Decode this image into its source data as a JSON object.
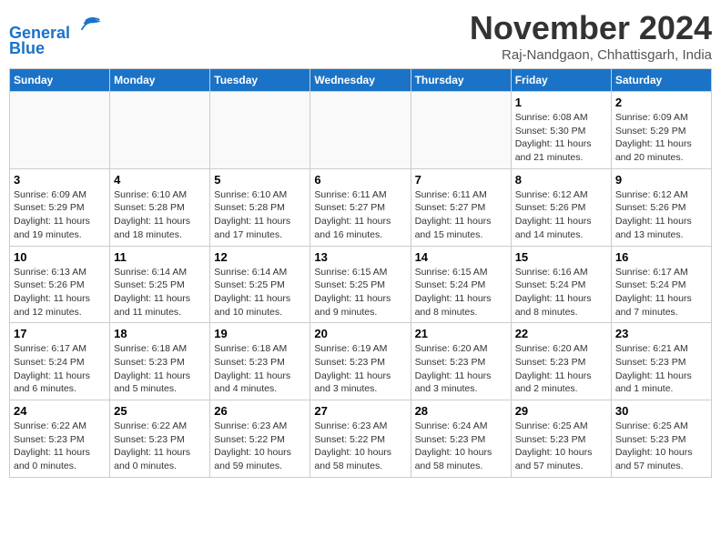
{
  "header": {
    "logo_line1": "General",
    "logo_line2": "Blue",
    "month_title": "November 2024",
    "location": "Raj-Nandgaon, Chhattisgarh, India"
  },
  "weekdays": [
    "Sunday",
    "Monday",
    "Tuesday",
    "Wednesday",
    "Thursday",
    "Friday",
    "Saturday"
  ],
  "weeks": [
    [
      {
        "day": "",
        "info": ""
      },
      {
        "day": "",
        "info": ""
      },
      {
        "day": "",
        "info": ""
      },
      {
        "day": "",
        "info": ""
      },
      {
        "day": "",
        "info": ""
      },
      {
        "day": "1",
        "info": "Sunrise: 6:08 AM\nSunset: 5:30 PM\nDaylight: 11 hours and 21 minutes."
      },
      {
        "day": "2",
        "info": "Sunrise: 6:09 AM\nSunset: 5:29 PM\nDaylight: 11 hours and 20 minutes."
      }
    ],
    [
      {
        "day": "3",
        "info": "Sunrise: 6:09 AM\nSunset: 5:29 PM\nDaylight: 11 hours and 19 minutes."
      },
      {
        "day": "4",
        "info": "Sunrise: 6:10 AM\nSunset: 5:28 PM\nDaylight: 11 hours and 18 minutes."
      },
      {
        "day": "5",
        "info": "Sunrise: 6:10 AM\nSunset: 5:28 PM\nDaylight: 11 hours and 17 minutes."
      },
      {
        "day": "6",
        "info": "Sunrise: 6:11 AM\nSunset: 5:27 PM\nDaylight: 11 hours and 16 minutes."
      },
      {
        "day": "7",
        "info": "Sunrise: 6:11 AM\nSunset: 5:27 PM\nDaylight: 11 hours and 15 minutes."
      },
      {
        "day": "8",
        "info": "Sunrise: 6:12 AM\nSunset: 5:26 PM\nDaylight: 11 hours and 14 minutes."
      },
      {
        "day": "9",
        "info": "Sunrise: 6:12 AM\nSunset: 5:26 PM\nDaylight: 11 hours and 13 minutes."
      }
    ],
    [
      {
        "day": "10",
        "info": "Sunrise: 6:13 AM\nSunset: 5:26 PM\nDaylight: 11 hours and 12 minutes."
      },
      {
        "day": "11",
        "info": "Sunrise: 6:14 AM\nSunset: 5:25 PM\nDaylight: 11 hours and 11 minutes."
      },
      {
        "day": "12",
        "info": "Sunrise: 6:14 AM\nSunset: 5:25 PM\nDaylight: 11 hours and 10 minutes."
      },
      {
        "day": "13",
        "info": "Sunrise: 6:15 AM\nSunset: 5:25 PM\nDaylight: 11 hours and 9 minutes."
      },
      {
        "day": "14",
        "info": "Sunrise: 6:15 AM\nSunset: 5:24 PM\nDaylight: 11 hours and 8 minutes."
      },
      {
        "day": "15",
        "info": "Sunrise: 6:16 AM\nSunset: 5:24 PM\nDaylight: 11 hours and 8 minutes."
      },
      {
        "day": "16",
        "info": "Sunrise: 6:17 AM\nSunset: 5:24 PM\nDaylight: 11 hours and 7 minutes."
      }
    ],
    [
      {
        "day": "17",
        "info": "Sunrise: 6:17 AM\nSunset: 5:24 PM\nDaylight: 11 hours and 6 minutes."
      },
      {
        "day": "18",
        "info": "Sunrise: 6:18 AM\nSunset: 5:23 PM\nDaylight: 11 hours and 5 minutes."
      },
      {
        "day": "19",
        "info": "Sunrise: 6:18 AM\nSunset: 5:23 PM\nDaylight: 11 hours and 4 minutes."
      },
      {
        "day": "20",
        "info": "Sunrise: 6:19 AM\nSunset: 5:23 PM\nDaylight: 11 hours and 3 minutes."
      },
      {
        "day": "21",
        "info": "Sunrise: 6:20 AM\nSunset: 5:23 PM\nDaylight: 11 hours and 3 minutes."
      },
      {
        "day": "22",
        "info": "Sunrise: 6:20 AM\nSunset: 5:23 PM\nDaylight: 11 hours and 2 minutes."
      },
      {
        "day": "23",
        "info": "Sunrise: 6:21 AM\nSunset: 5:23 PM\nDaylight: 11 hours and 1 minute."
      }
    ],
    [
      {
        "day": "24",
        "info": "Sunrise: 6:22 AM\nSunset: 5:23 PM\nDaylight: 11 hours and 0 minutes."
      },
      {
        "day": "25",
        "info": "Sunrise: 6:22 AM\nSunset: 5:23 PM\nDaylight: 11 hours and 0 minutes."
      },
      {
        "day": "26",
        "info": "Sunrise: 6:23 AM\nSunset: 5:22 PM\nDaylight: 10 hours and 59 minutes."
      },
      {
        "day": "27",
        "info": "Sunrise: 6:23 AM\nSunset: 5:22 PM\nDaylight: 10 hours and 58 minutes."
      },
      {
        "day": "28",
        "info": "Sunrise: 6:24 AM\nSunset: 5:23 PM\nDaylight: 10 hours and 58 minutes."
      },
      {
        "day": "29",
        "info": "Sunrise: 6:25 AM\nSunset: 5:23 PM\nDaylight: 10 hours and 57 minutes."
      },
      {
        "day": "30",
        "info": "Sunrise: 6:25 AM\nSunset: 5:23 PM\nDaylight: 10 hours and 57 minutes."
      }
    ]
  ]
}
